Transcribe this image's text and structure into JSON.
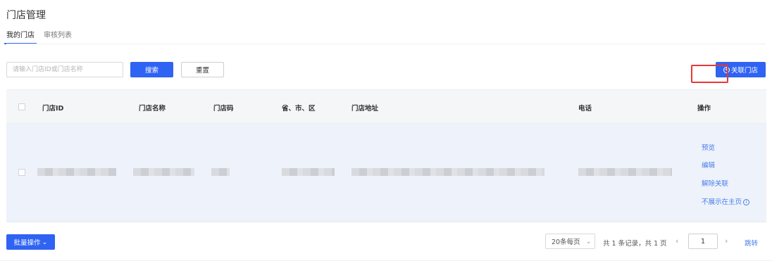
{
  "page": {
    "title": "门店管理"
  },
  "tabs": [
    {
      "label": "我的门店",
      "active": true
    },
    {
      "label": "审核列表",
      "active": false
    }
  ],
  "search": {
    "placeholder": "请输入门店ID或门店名称",
    "value": "",
    "search_label": "搜索",
    "reset_label": "重置"
  },
  "link_store_button": {
    "label": "关联门店",
    "icon": "plus-circle-icon"
  },
  "table": {
    "columns": [
      "门店ID",
      "门店名称",
      "门店码",
      "省、市、区",
      "门店地址",
      "电话",
      "操作"
    ],
    "rows": [
      {
        "cells": [
          "(redacted)",
          "(redacted)",
          "(redacted)",
          "(redacted)",
          "(redacted)",
          "(redacted)"
        ],
        "actions": {
          "preview": "预览",
          "edit": "编辑",
          "unlink": "解除关联",
          "hide_home": "不展示在主页"
        }
      }
    ]
  },
  "footer": {
    "batch_label": "批量操作",
    "page_size": "20条每页",
    "summary": "共 1 条记录，共 1 页",
    "current_page": "1",
    "jump_label": "跳转"
  },
  "colors": {
    "primary": "#2f63f3",
    "link": "#4a7de8",
    "highlight": "#e53935",
    "row_bg": "#edf2fb"
  }
}
